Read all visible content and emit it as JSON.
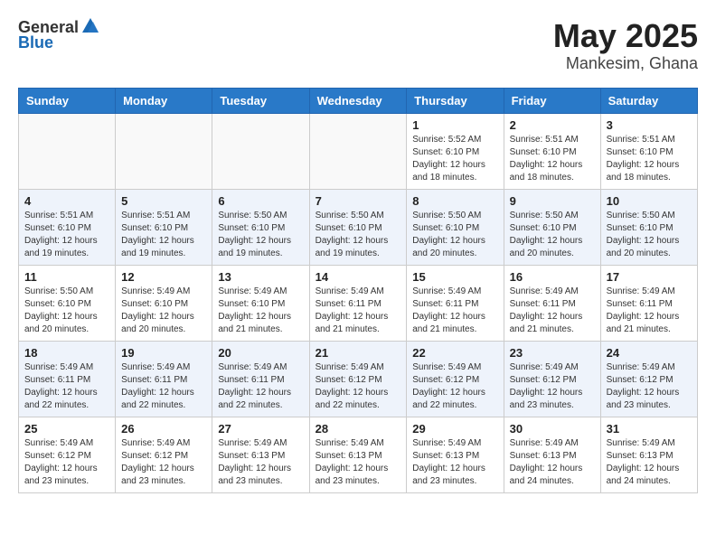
{
  "header": {
    "logo_general": "General",
    "logo_blue": "Blue",
    "month": "May 2025",
    "location": "Mankesim, Ghana"
  },
  "weekdays": [
    "Sunday",
    "Monday",
    "Tuesday",
    "Wednesday",
    "Thursday",
    "Friday",
    "Saturday"
  ],
  "weeks": [
    [
      {
        "day": "",
        "info": ""
      },
      {
        "day": "",
        "info": ""
      },
      {
        "day": "",
        "info": ""
      },
      {
        "day": "",
        "info": ""
      },
      {
        "day": "1",
        "info": "Sunrise: 5:52 AM\nSunset: 6:10 PM\nDaylight: 12 hours\nand 18 minutes."
      },
      {
        "day": "2",
        "info": "Sunrise: 5:51 AM\nSunset: 6:10 PM\nDaylight: 12 hours\nand 18 minutes."
      },
      {
        "day": "3",
        "info": "Sunrise: 5:51 AM\nSunset: 6:10 PM\nDaylight: 12 hours\nand 18 minutes."
      }
    ],
    [
      {
        "day": "4",
        "info": "Sunrise: 5:51 AM\nSunset: 6:10 PM\nDaylight: 12 hours\nand 19 minutes."
      },
      {
        "day": "5",
        "info": "Sunrise: 5:51 AM\nSunset: 6:10 PM\nDaylight: 12 hours\nand 19 minutes."
      },
      {
        "day": "6",
        "info": "Sunrise: 5:50 AM\nSunset: 6:10 PM\nDaylight: 12 hours\nand 19 minutes."
      },
      {
        "day": "7",
        "info": "Sunrise: 5:50 AM\nSunset: 6:10 PM\nDaylight: 12 hours\nand 19 minutes."
      },
      {
        "day": "8",
        "info": "Sunrise: 5:50 AM\nSunset: 6:10 PM\nDaylight: 12 hours\nand 20 minutes."
      },
      {
        "day": "9",
        "info": "Sunrise: 5:50 AM\nSunset: 6:10 PM\nDaylight: 12 hours\nand 20 minutes."
      },
      {
        "day": "10",
        "info": "Sunrise: 5:50 AM\nSunset: 6:10 PM\nDaylight: 12 hours\nand 20 minutes."
      }
    ],
    [
      {
        "day": "11",
        "info": "Sunrise: 5:50 AM\nSunset: 6:10 PM\nDaylight: 12 hours\nand 20 minutes."
      },
      {
        "day": "12",
        "info": "Sunrise: 5:49 AM\nSunset: 6:10 PM\nDaylight: 12 hours\nand 20 minutes."
      },
      {
        "day": "13",
        "info": "Sunrise: 5:49 AM\nSunset: 6:10 PM\nDaylight: 12 hours\nand 21 minutes."
      },
      {
        "day": "14",
        "info": "Sunrise: 5:49 AM\nSunset: 6:11 PM\nDaylight: 12 hours\nand 21 minutes."
      },
      {
        "day": "15",
        "info": "Sunrise: 5:49 AM\nSunset: 6:11 PM\nDaylight: 12 hours\nand 21 minutes."
      },
      {
        "day": "16",
        "info": "Sunrise: 5:49 AM\nSunset: 6:11 PM\nDaylight: 12 hours\nand 21 minutes."
      },
      {
        "day": "17",
        "info": "Sunrise: 5:49 AM\nSunset: 6:11 PM\nDaylight: 12 hours\nand 21 minutes."
      }
    ],
    [
      {
        "day": "18",
        "info": "Sunrise: 5:49 AM\nSunset: 6:11 PM\nDaylight: 12 hours\nand 22 minutes."
      },
      {
        "day": "19",
        "info": "Sunrise: 5:49 AM\nSunset: 6:11 PM\nDaylight: 12 hours\nand 22 minutes."
      },
      {
        "day": "20",
        "info": "Sunrise: 5:49 AM\nSunset: 6:11 PM\nDaylight: 12 hours\nand 22 minutes."
      },
      {
        "day": "21",
        "info": "Sunrise: 5:49 AM\nSunset: 6:12 PM\nDaylight: 12 hours\nand 22 minutes."
      },
      {
        "day": "22",
        "info": "Sunrise: 5:49 AM\nSunset: 6:12 PM\nDaylight: 12 hours\nand 22 minutes."
      },
      {
        "day": "23",
        "info": "Sunrise: 5:49 AM\nSunset: 6:12 PM\nDaylight: 12 hours\nand 23 minutes."
      },
      {
        "day": "24",
        "info": "Sunrise: 5:49 AM\nSunset: 6:12 PM\nDaylight: 12 hours\nand 23 minutes."
      }
    ],
    [
      {
        "day": "25",
        "info": "Sunrise: 5:49 AM\nSunset: 6:12 PM\nDaylight: 12 hours\nand 23 minutes."
      },
      {
        "day": "26",
        "info": "Sunrise: 5:49 AM\nSunset: 6:12 PM\nDaylight: 12 hours\nand 23 minutes."
      },
      {
        "day": "27",
        "info": "Sunrise: 5:49 AM\nSunset: 6:13 PM\nDaylight: 12 hours\nand 23 minutes."
      },
      {
        "day": "28",
        "info": "Sunrise: 5:49 AM\nSunset: 6:13 PM\nDaylight: 12 hours\nand 23 minutes."
      },
      {
        "day": "29",
        "info": "Sunrise: 5:49 AM\nSunset: 6:13 PM\nDaylight: 12 hours\nand 23 minutes."
      },
      {
        "day": "30",
        "info": "Sunrise: 5:49 AM\nSunset: 6:13 PM\nDaylight: 12 hours\nand 24 minutes."
      },
      {
        "day": "31",
        "info": "Sunrise: 5:49 AM\nSunset: 6:13 PM\nDaylight: 12 hours\nand 24 minutes."
      }
    ]
  ]
}
